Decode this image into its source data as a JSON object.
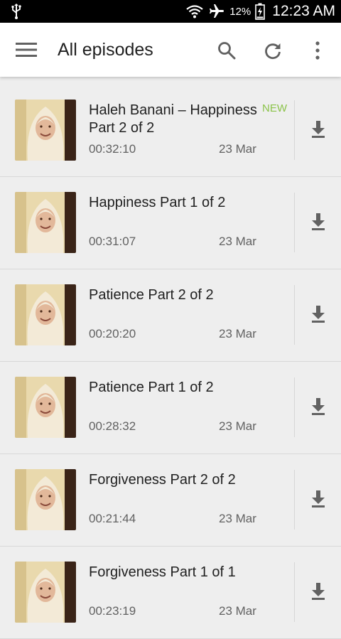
{
  "status_bar": {
    "battery_percent": "12%",
    "time": "12:23 AM"
  },
  "toolbar": {
    "title": "All episodes"
  },
  "episodes": [
    {
      "title": "Haleh Banani – Happiness Part 2 of 2",
      "duration": "00:32:10",
      "date": "23 Mar",
      "badge": "NEW"
    },
    {
      "title": "Happiness Part 1 of 2",
      "duration": "00:31:07",
      "date": "23 Mar",
      "badge": ""
    },
    {
      "title": "Patience Part 2 of 2",
      "duration": "00:20:20",
      "date": "23 Mar",
      "badge": ""
    },
    {
      "title": "Patience Part 1 of 2",
      "duration": "00:28:32",
      "date": "23 Mar",
      "badge": ""
    },
    {
      "title": "Forgiveness Part 2 of 2",
      "duration": "00:21:44",
      "date": "23 Mar",
      "badge": ""
    },
    {
      "title": "Forgiveness Part 1 of 1",
      "duration": "00:23:19",
      "date": "23 Mar",
      "badge": ""
    }
  ],
  "colors": {
    "new_badge": "#8bc34a",
    "background": "#eeeeee",
    "toolbar": "#ffffff"
  }
}
